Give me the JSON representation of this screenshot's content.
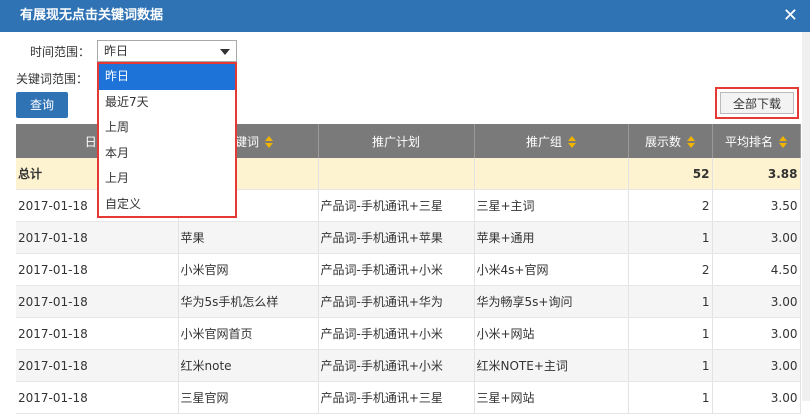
{
  "dialog": {
    "title": "有展现无点击关键词数据",
    "close_glyph": "✕"
  },
  "filters": {
    "time_label": "时间范围：",
    "keyword_label": "关键词范围：",
    "time_selected": "昨日",
    "time_options": [
      "昨日",
      "最近7天",
      "上周",
      "本月",
      "上月",
      "自定义"
    ]
  },
  "buttons": {
    "query": "查询",
    "download_all": "全部下载"
  },
  "table": {
    "headers": [
      "日期",
      "关键词",
      "推广计划",
      "推广组",
      "展示数",
      "平均排名"
    ],
    "total": {
      "label": "总计",
      "impressions": "52",
      "avg_rank": "3.88"
    },
    "rows": [
      [
        "2017-01-18",
        "",
        "产品词-手机通讯+三星",
        "三星+主词",
        "2",
        "3.50"
      ],
      [
        "2017-01-18",
        "苹果",
        "产品词-手机通讯+苹果",
        "苹果+通用",
        "1",
        "3.00"
      ],
      [
        "2017-01-18",
        "小米官网",
        "产品词-手机通讯+小米",
        "小米4s+官网",
        "2",
        "4.50"
      ],
      [
        "2017-01-18",
        "华为5s手机怎么样",
        "产品词-手机通讯+华为",
        "华为畅享5s+询问",
        "1",
        "3.00"
      ],
      [
        "2017-01-18",
        "小米官网首页",
        "产品词-手机通讯+小米",
        "小米+网站",
        "1",
        "3.00"
      ],
      [
        "2017-01-18",
        "红米note",
        "产品词-手机通讯+小米",
        "红米NOTE+主词",
        "1",
        "3.00"
      ],
      [
        "2017-01-18",
        "三星官网",
        "产品词-手机通讯+三星",
        "三星+网站",
        "1",
        "3.00"
      ]
    ]
  }
}
